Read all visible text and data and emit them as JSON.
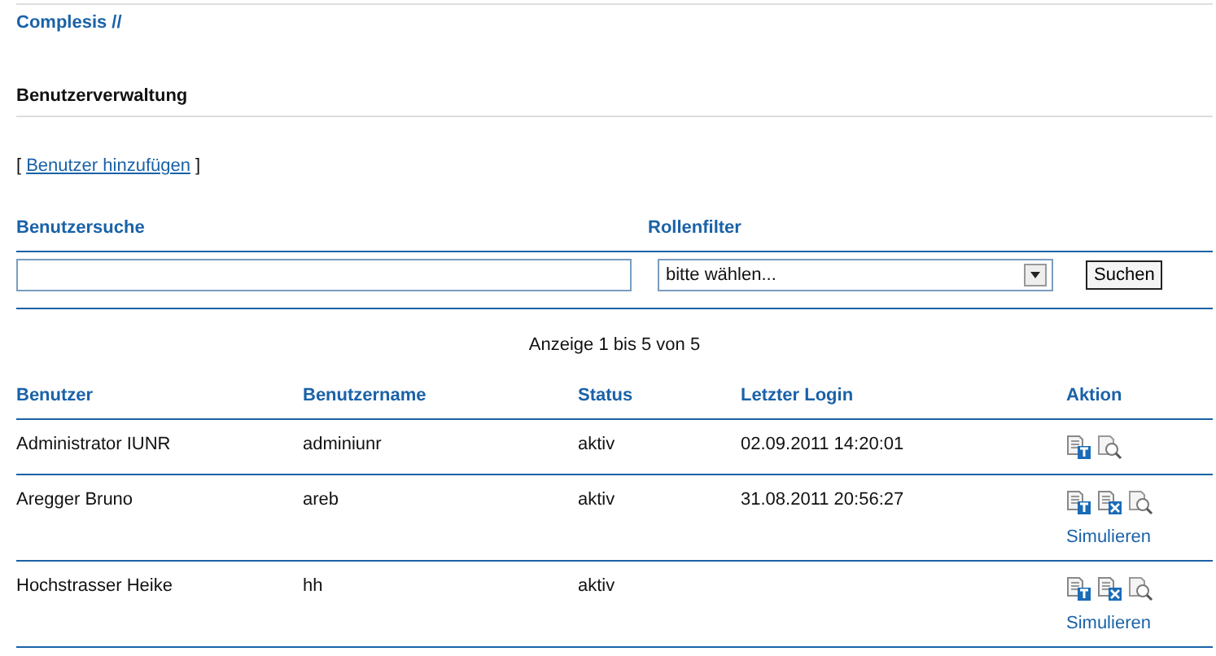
{
  "breadcrumb": "Complesis //",
  "page_title": "Benutzerverwaltung",
  "add_link": {
    "open": "[",
    "label": "Benutzer hinzufügen",
    "close": "]"
  },
  "search": {
    "label": "Benutzersuche"
  },
  "role_filter": {
    "label": "Rollenfilter",
    "value": "bitte wählen..."
  },
  "search_button": "Suchen",
  "paging": "Anzeige 1 bis 5 von 5",
  "table": {
    "columns": [
      "Benutzer",
      "Benutzername",
      "Status",
      "Letzter Login",
      "Aktion"
    ],
    "rows": [
      {
        "name": "Administrator IUNR",
        "username": "adminiunr",
        "status": "aktiv",
        "last_login": "02.09.2011 14:20:01",
        "actions": [
          {
            "kind": "edit"
          },
          {
            "kind": "view"
          }
        ]
      },
      {
        "name": "Aregger Bruno",
        "username": "areb",
        "status": "aktiv",
        "last_login": "31.08.2011 20:56:27",
        "actions": [
          {
            "kind": "edit"
          },
          {
            "kind": "delete"
          },
          {
            "kind": "view"
          }
        ],
        "simulate": "Simulieren"
      },
      {
        "name": "Hochstrasser Heike",
        "username": "hh",
        "status": "aktiv",
        "actions": [
          {
            "kind": "edit"
          },
          {
            "kind": "delete"
          },
          {
            "kind": "view"
          }
        ],
        "simulate": "Simulieren"
      }
    ]
  }
}
